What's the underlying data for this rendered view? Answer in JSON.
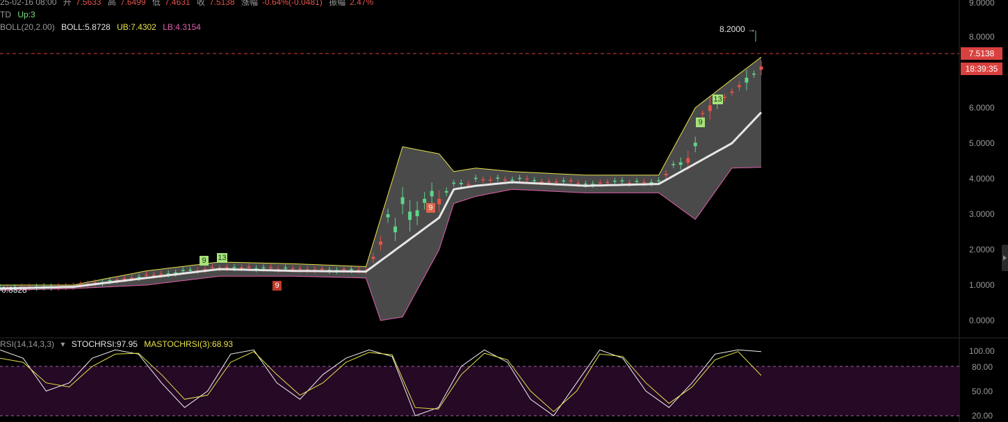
{
  "header": {
    "ohlc": {
      "date_fragment": "25-02-16 08:00",
      "open_label": "开",
      "open": "7.5633",
      "high_label": "高",
      "high": "7.6499",
      "low_label": "低",
      "low": "7.4631",
      "close_label": "收",
      "close": "7.5138",
      "change_label": "涨幅",
      "change": "-0.64%(-0.0481)",
      "amplitude_label": "振幅",
      "amplitude": "2.47%"
    },
    "td": {
      "label": "TD",
      "value": "Up:3"
    },
    "boll": {
      "label": "BOLL(20,2.00)",
      "mid": "BOLL:5.8728",
      "ub": "UB:7.4302",
      "lb": "LB:4.3154"
    }
  },
  "price_axis": {
    "ticks": [
      "9.0000",
      "8.0000",
      "6.0000",
      "5.0000",
      "4.0000",
      "3.0000",
      "2.0000",
      "1.0000",
      "0.0000"
    ],
    "current_price": "7.5138",
    "countdown": "18:39:35",
    "high_marker": "8.2000 →",
    "low_marker": "0.8328"
  },
  "td_markers": [
    {
      "text": "9",
      "kind": "up"
    },
    {
      "text": "13",
      "kind": "up"
    },
    {
      "text": "9",
      "kind": "down"
    },
    {
      "text": "9",
      "kind": "down"
    },
    {
      "text": "9",
      "kind": "up"
    },
    {
      "text": "13",
      "kind": "up"
    }
  ],
  "stoch_panel": {
    "label": "RSI(14,14,3,3)",
    "stoch": "STOCHRSI:97.95",
    "ma": "MASTOCHRSI(3):68.93",
    "ticks": [
      "100.00",
      "80.00",
      "50.00",
      "20.00"
    ]
  },
  "colors": {
    "up": "#5fd38a",
    "down": "#e5534b",
    "mid_band": "#e6e6e6",
    "upper_band": "#e8e24a",
    "lower_band": "#e05fae",
    "band_fill": "#4a4a4a",
    "stoch_fill": "#250925",
    "stoch_k": "#f2f2f2",
    "stoch_d": "#e8e24a"
  },
  "chart_data": [
    {
      "type": "line",
      "title": "BOLL(20,2.00)",
      "ylim": [
        0,
        9
      ],
      "series": [
        {
          "name": "BOLL",
          "x": [
            0,
            10,
            20,
            30,
            40,
            50,
            60,
            62,
            65,
            70,
            75,
            80,
            90,
            100,
            104
          ],
          "values": [
            0.9,
            0.95,
            1.2,
            1.45,
            1.4,
            1.38,
            2.9,
            3.7,
            3.8,
            3.9,
            3.85,
            3.8,
            3.85,
            5.0,
            5.87
          ]
        },
        {
          "name": "UB",
          "x": [
            0,
            10,
            20,
            30,
            40,
            50,
            55,
            60,
            62,
            65,
            70,
            80,
            90,
            95,
            100,
            104
          ],
          "values": [
            1.0,
            1.0,
            1.4,
            1.65,
            1.6,
            1.52,
            4.9,
            4.7,
            4.2,
            4.3,
            4.2,
            4.1,
            4.1,
            6.0,
            6.8,
            7.43
          ]
        },
        {
          "name": "LB",
          "x": [
            0,
            10,
            20,
            30,
            40,
            50,
            52,
            55,
            60,
            62,
            65,
            70,
            80,
            90,
            95,
            100,
            104
          ],
          "values": [
            0.85,
            0.9,
            1.0,
            1.25,
            1.25,
            1.2,
            0.0,
            0.1,
            2.0,
            3.3,
            3.5,
            3.7,
            3.6,
            3.6,
            2.85,
            4.3,
            4.32
          ]
        }
      ]
    },
    {
      "type": "line",
      "title": "STOCHRSI(14,14,3,3)",
      "ylim": [
        20,
        100
      ],
      "series": [
        {
          "name": "STOCHRSI",
          "values": [
            100,
            90,
            50,
            60,
            90,
            100,
            95,
            60,
            30,
            50,
            95,
            100,
            60,
            40,
            70,
            90,
            100,
            92,
            20,
            30,
            80,
            100,
            85,
            40,
            20,
            60,
            100,
            90,
            50,
            30,
            60,
            95,
            100,
            97.95
          ]
        },
        {
          "name": "MASTOCHRSI(3)",
          "values": [
            90,
            85,
            60,
            55,
            80,
            95,
            96,
            70,
            40,
            45,
            85,
            98,
            70,
            45,
            60,
            85,
            97,
            94,
            30,
            28,
            70,
            96,
            88,
            50,
            25,
            50,
            95,
            92,
            60,
            35,
            55,
            88,
            98,
            68.93
          ]
        }
      ]
    }
  ]
}
